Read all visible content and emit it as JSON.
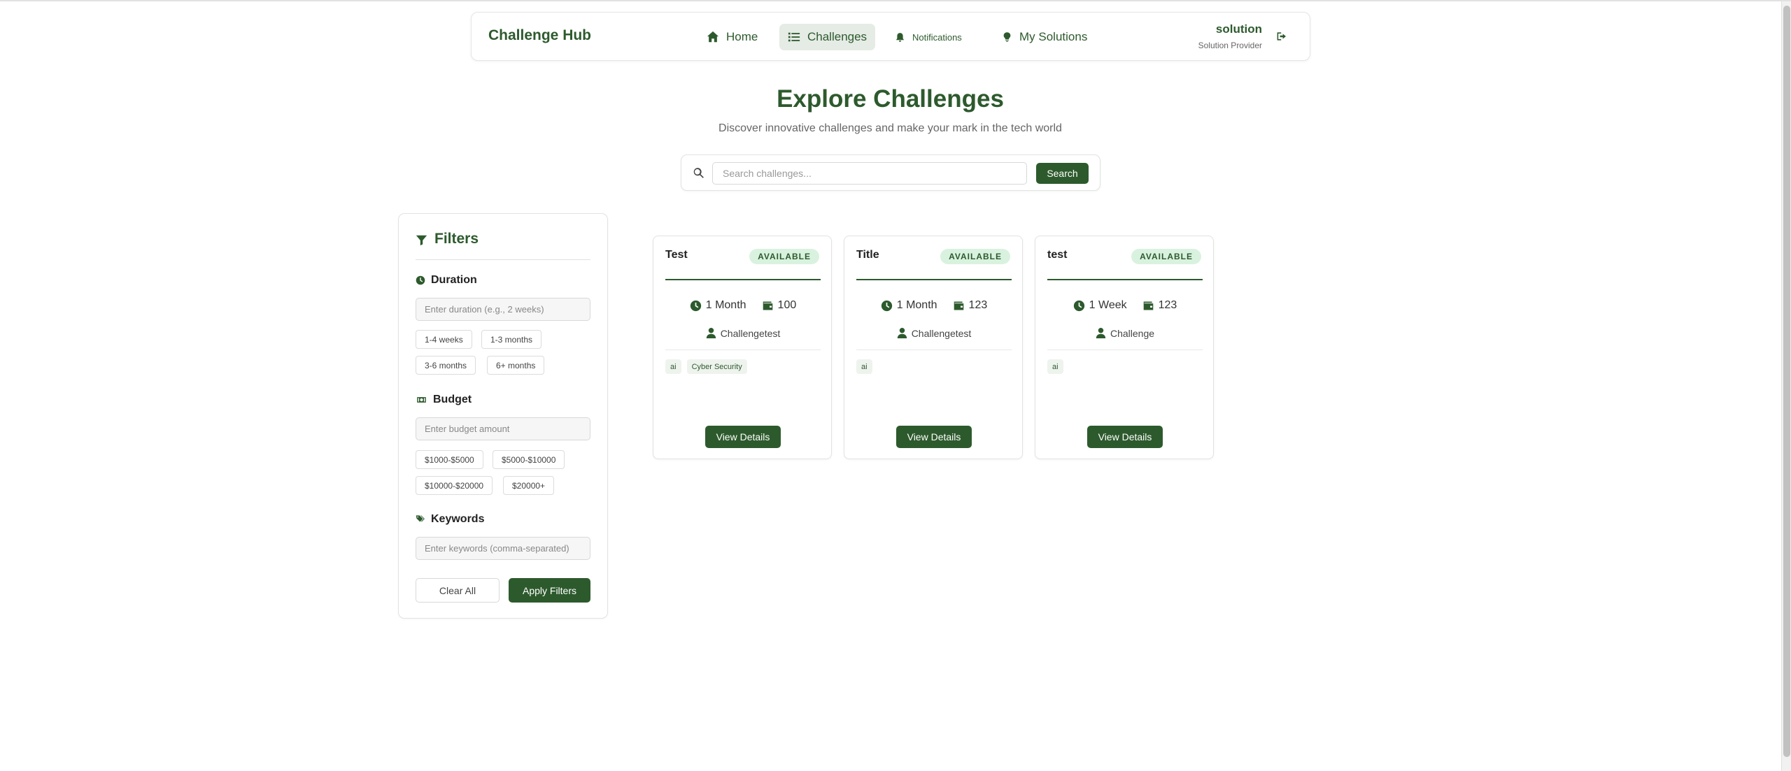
{
  "nav": {
    "brand": "Challenge Hub",
    "items": [
      {
        "label": "Home",
        "icon": "home-icon"
      },
      {
        "label": "Challenges",
        "icon": "list-icon",
        "active": true
      },
      {
        "label": "Notifications",
        "icon": "bell-icon"
      },
      {
        "label": "My Solutions",
        "icon": "lightbulb-icon"
      }
    ],
    "user": {
      "name": "solution",
      "role": "Solution Provider"
    },
    "logout_icon": "logout-icon"
  },
  "hero": {
    "title": "Explore Challenges",
    "subtitle": "Discover innovative challenges and make your mark in the tech world"
  },
  "search": {
    "placeholder": "Search challenges...",
    "button_label": "Search"
  },
  "filters": {
    "title": "Filters",
    "duration": {
      "label": "Duration",
      "placeholder": "Enter duration (e.g., 2 weeks)",
      "chips": [
        "1-4 weeks",
        "1-3 months",
        "3-6 months",
        "6+ months"
      ]
    },
    "budget": {
      "label": "Budget",
      "placeholder": "Enter budget amount",
      "chips": [
        "$1000-$5000",
        "$5000-$10000",
        "$10000-$20000",
        "$20000+"
      ]
    },
    "keywords": {
      "label": "Keywords",
      "placeholder": "Enter keywords (comma-separated)"
    },
    "clear_label": "Clear All",
    "apply_label": "Apply Filters"
  },
  "challenges": [
    {
      "title": "Test",
      "status": "AVAILABLE",
      "duration": "1 Month",
      "budget": "100",
      "author": "Challengetest",
      "tags": [
        "ai",
        "Cyber Security"
      ],
      "button_label": "View Details"
    },
    {
      "title": "Title",
      "status": "AVAILABLE",
      "duration": "1 Month",
      "budget": "123",
      "author": "Challengetest",
      "tags": [
        "ai"
      ],
      "button_label": "View Details"
    },
    {
      "title": "test",
      "status": "AVAILABLE",
      "duration": "1 Week",
      "budget": "123",
      "author": "Challenge",
      "tags": [
        "ai"
      ],
      "button_label": "View Details"
    }
  ],
  "colors": {
    "accent": "#2d5a2d",
    "badge_bg": "#d9f2df",
    "tag_bg": "#eef3ee"
  }
}
